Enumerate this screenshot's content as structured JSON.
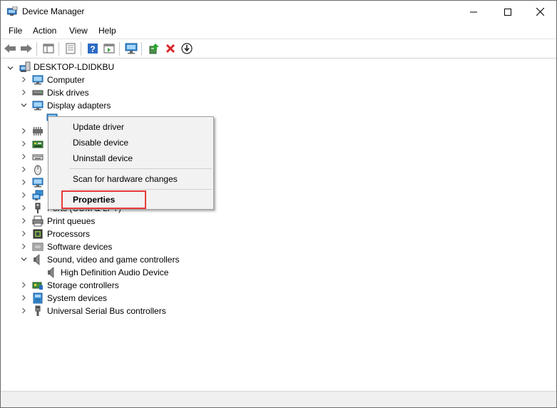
{
  "window": {
    "title": "Device Manager",
    "controls": {
      "minimize": "minimize",
      "maximize": "maximize",
      "close": "close"
    }
  },
  "menubar": {
    "items": [
      "File",
      "Action",
      "View",
      "Help"
    ]
  },
  "toolbar": {
    "buttons": [
      "back-arrow",
      "forward-arrow",
      "show-hide-console-tree",
      "properties",
      "help",
      "action-pane",
      "monitor-scan",
      "update-driver",
      "uninstall-device",
      "install-driver"
    ]
  },
  "tree": {
    "root": "DESKTOP-LDIDKBU",
    "items": [
      {
        "label": "Computer",
        "icon": "computer-icon",
        "expanded": false
      },
      {
        "label": "Disk drives",
        "icon": "disk-drive-icon",
        "expanded": false
      },
      {
        "label": "Display adapters",
        "icon": "display-adapter-icon",
        "expanded": true
      },
      {
        "label": "",
        "icon": "display-device-icon",
        "child": true,
        "selected": true
      },
      {
        "label": "",
        "icon": "firmware-icon",
        "expanded": false
      },
      {
        "label": "",
        "icon": "hid-icon",
        "expanded": false
      },
      {
        "label": "",
        "icon": "keyboard-icon",
        "expanded": false
      },
      {
        "label": "",
        "icon": "mouse-icon",
        "expanded": false
      },
      {
        "label": "",
        "icon": "monitor-icon",
        "expanded": false
      },
      {
        "label": "",
        "icon": "network-adapter-icon",
        "expanded": false
      },
      {
        "label": "Ports (COM & LPT)",
        "icon": "port-icon",
        "expanded": false
      },
      {
        "label": "Print queues",
        "icon": "printer-icon",
        "expanded": false
      },
      {
        "label": "Processors",
        "icon": "processor-icon",
        "expanded": false
      },
      {
        "label": "Software devices",
        "icon": "software-device-icon",
        "expanded": false
      },
      {
        "label": "Sound, video and game controllers",
        "icon": "speaker-icon",
        "expanded": true
      },
      {
        "label": "High Definition Audio Device",
        "icon": "speaker-icon",
        "child": true
      },
      {
        "label": "Storage controllers",
        "icon": "storage-controller-icon",
        "expanded": false
      },
      {
        "label": "System devices",
        "icon": "system-device-icon",
        "expanded": false
      },
      {
        "label": "Universal Serial Bus controllers",
        "icon": "usb-icon",
        "expanded": false
      }
    ]
  },
  "context_menu": {
    "items": [
      "Update driver",
      "Disable device",
      "Uninstall device",
      "Scan for hardware changes",
      "Properties"
    ],
    "default_item": "Properties"
  },
  "colors": {
    "highlight_border": "#e83a3a",
    "close_x": "#d9262a",
    "monitor_blue": "#3a8fd6"
  }
}
